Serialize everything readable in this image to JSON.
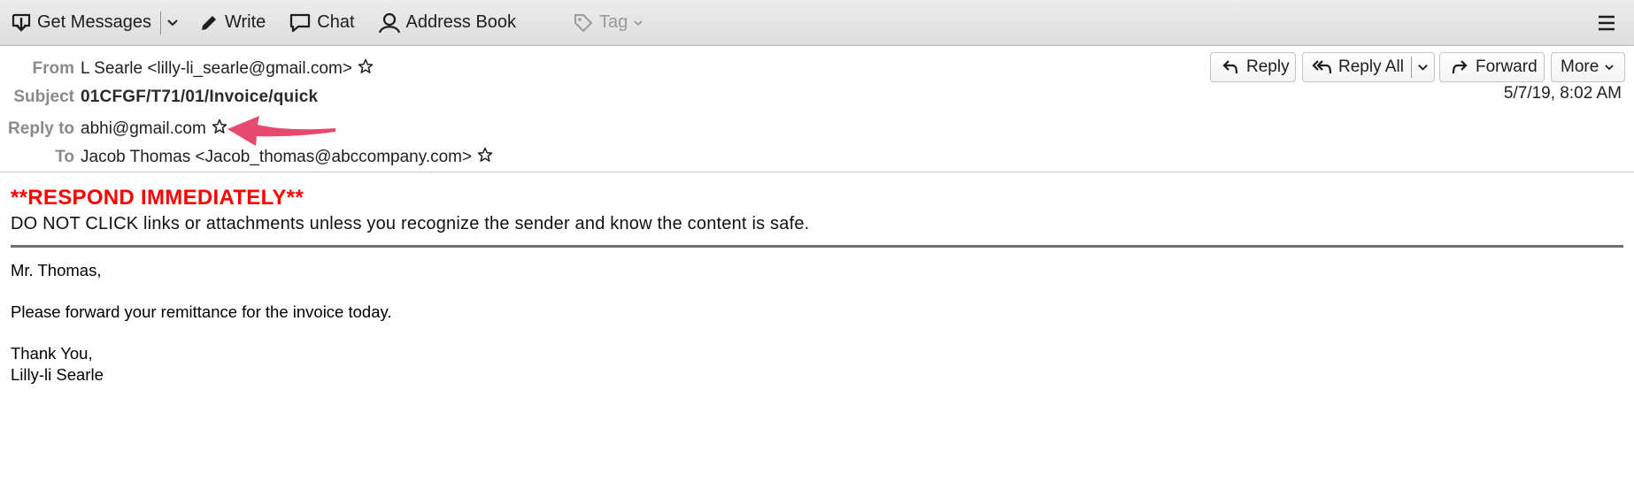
{
  "toolbar": {
    "get_messages": "Get Messages",
    "write": "Write",
    "chat": "Chat",
    "address_book": "Address Book",
    "tag": "Tag"
  },
  "header": {
    "from_label": "From",
    "from_value": "L Searle <lilly-li_searle@gmail.com>",
    "subject_label": "Subject",
    "subject_value": "01CFGF/T71/01/Invoice/quick",
    "reply_to_label": "Reply to",
    "reply_to_value": "abhi@gmail.com",
    "to_label": "To",
    "to_value": "Jacob Thomas <Jacob_thomas@abccompany.com>",
    "date": "5/7/19, 8:02 AM",
    "buttons": {
      "reply": "Reply",
      "reply_all": "Reply All",
      "forward": "Forward",
      "more": "More"
    }
  },
  "body": {
    "banner_title": "**RESPOND IMMEDIATELY**",
    "banner_text": "DO NOT CLICK links or attachments unless you recognize the sender and know the content is safe.",
    "greeting": "Mr. Thomas,",
    "line1": "Please forward your remittance for the invoice today.",
    "closing": "Thank You,",
    "signature": "Lilly-li Searle"
  },
  "colors": {
    "annotation_arrow": "#e8496e",
    "banner_red": "#ff0000",
    "label_gray": "#8a8a8a"
  }
}
